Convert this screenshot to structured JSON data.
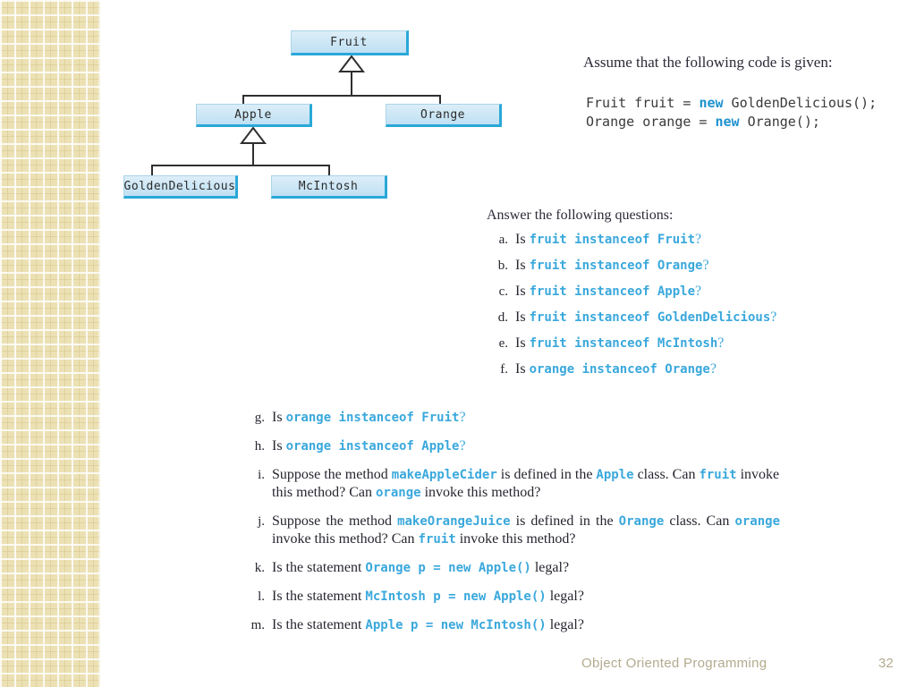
{
  "slide": {
    "footer_title": "Object Oriented Programming",
    "page_number": "32"
  },
  "colors": {
    "border_tile": "#ece1b4",
    "box_fill": "#cfe8f6",
    "box_edge": "#29a8d8",
    "code_accent": "#3aa8dc",
    "keyword": "#1f93cf",
    "footer_text": "#b3aa8e"
  },
  "diagram": {
    "type": "uml-class-hierarchy",
    "nodes": [
      {
        "id": "fruit",
        "label": "Fruit"
      },
      {
        "id": "apple",
        "label": "Apple"
      },
      {
        "id": "orange",
        "label": "Orange"
      },
      {
        "id": "goldendelicious",
        "label": "GoldenDelicious"
      },
      {
        "id": "mcintosh",
        "label": "McIntosh"
      }
    ],
    "edges": [
      {
        "from": "apple",
        "to": "fruit",
        "kind": "inheritance"
      },
      {
        "from": "orange",
        "to": "fruit",
        "kind": "inheritance"
      },
      {
        "from": "goldendelicious",
        "to": "apple",
        "kind": "inheritance"
      },
      {
        "from": "mcintosh",
        "to": "apple",
        "kind": "inheritance"
      }
    ]
  },
  "assume": {
    "heading": "Assume that the following code is given:",
    "code_lines": [
      {
        "before": "Fruit fruit = ",
        "keyword": "new",
        "after": " GoldenDelicious();"
      },
      {
        "before": "Orange orange = ",
        "keyword": "new",
        "after": " Orange();"
      }
    ]
  },
  "questions": {
    "heading": "Answer the following questions:",
    "items": [
      {
        "marker": "a.",
        "is": "Is",
        "code": "fruit instanceof Fruit",
        "tail": "?"
      },
      {
        "marker": "b.",
        "is": "Is",
        "code": "fruit instanceof Orange",
        "tail": "?"
      },
      {
        "marker": "c.",
        "is": "Is",
        "code": "fruit instanceof Apple",
        "tail": "?"
      },
      {
        "marker": "d.",
        "is": "Is",
        "code": "fruit instanceof GoldenDelicious",
        "tail": "?"
      },
      {
        "marker": "e.",
        "is": "Is",
        "code": "fruit instanceof McIntosh",
        "tail": "?"
      },
      {
        "marker": "f.",
        "is": "Is",
        "code": "orange instanceof Orange",
        "tail": "?"
      },
      {
        "marker": "g.",
        "is": "Is",
        "code": "orange instanceof Fruit",
        "tail": "?"
      },
      {
        "marker": "h.",
        "is": "Is",
        "code": "orange instanceof Apple",
        "tail": "?"
      }
    ],
    "item_i": {
      "marker": "i.",
      "t1": "Suppose the method ",
      "c1": "makeAppleCider",
      "t2": " is defined in the ",
      "c2": "Apple",
      "t3": " class. Can ",
      "c3": "fruit",
      "t4": " invoke this method? Can ",
      "c4": "orange",
      "t5": " invoke this method?"
    },
    "item_j": {
      "marker": "j.",
      "t1": "Suppose the method ",
      "c1": "makeOrangeJuice",
      "t2": " is defined in the ",
      "c2": "Orange",
      "t3": " class. Can ",
      "c3": "orange",
      "t4": " invoke this method? Can ",
      "c4": "fruit",
      "t5": " invoke this method?"
    },
    "statements": [
      {
        "marker": "k.",
        "lead": "Is the statement ",
        "code": "Orange p = new Apple()",
        "tail": " legal?"
      },
      {
        "marker": "l.",
        "lead": "Is the statement ",
        "code": "McIntosh p = new Apple()",
        "tail": " legal?"
      },
      {
        "marker": "m.",
        "lead": "Is the statement ",
        "code": "Apple p = new McIntosh()",
        "tail": " legal?"
      }
    ]
  }
}
